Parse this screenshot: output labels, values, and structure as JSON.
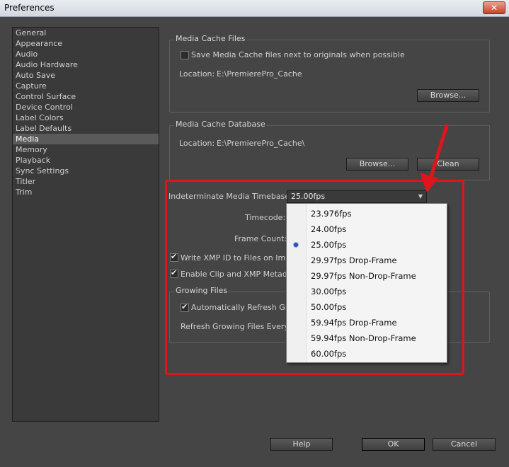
{
  "window": {
    "title": "Preferences",
    "close_label": "✕"
  },
  "sidebar": {
    "items": [
      "General",
      "Appearance",
      "Audio",
      "Audio Hardware",
      "Auto Save",
      "Capture",
      "Control Surface",
      "Device Control",
      "Label Colors",
      "Label Defaults",
      "Media",
      "Memory",
      "Playback",
      "Sync Settings",
      "Titler",
      "Trim"
    ],
    "selected": "Media"
  },
  "media_cache_files": {
    "title": "Media Cache Files",
    "save_next_to_originals_label": "Save Media Cache files next to originals when possible",
    "save_next_to_originals_checked": false,
    "location_label": "Location:",
    "location_value": "E:\\PremierePro_Cache",
    "browse_label": "Browse..."
  },
  "media_cache_database": {
    "title": "Media Cache Database",
    "location_label": "Location:",
    "location_value": "E:\\PremierePro_Cache\\",
    "browse_label": "Browse...",
    "clean_label": "Clean"
  },
  "timebase": {
    "label": "Indeterminate Media Timebase:",
    "value": "25.00fps",
    "options": [
      "23.976fps",
      "24.00fps",
      "25.00fps",
      "29.97fps Drop-Frame",
      "29.97fps Non-Drop-Frame",
      "30.00fps",
      "50.00fps",
      "59.94fps Drop-Frame",
      "59.94fps Non-Drop-Frame",
      "60.00fps"
    ],
    "selected_index": 2
  },
  "timecode_label": "Timecode:",
  "frame_count_label": "Frame Count:",
  "write_xmp": {
    "label": "Write XMP ID to Files on Impo",
    "checked": true
  },
  "enable_clip_xmp": {
    "label": "Enable Clip and XMP Metadat",
    "checked": true
  },
  "growing_files": {
    "title": "Growing Files",
    "auto_refresh_label": "Automatically Refresh Grov",
    "auto_refresh_checked": true,
    "refresh_every_label": "Refresh Growing Files Every"
  },
  "footer": {
    "help_label": "Help",
    "ok_label": "OK",
    "cancel_label": "Cancel"
  },
  "colors": {
    "highlight": "#e0141b",
    "radio": "#2b4fb5"
  }
}
